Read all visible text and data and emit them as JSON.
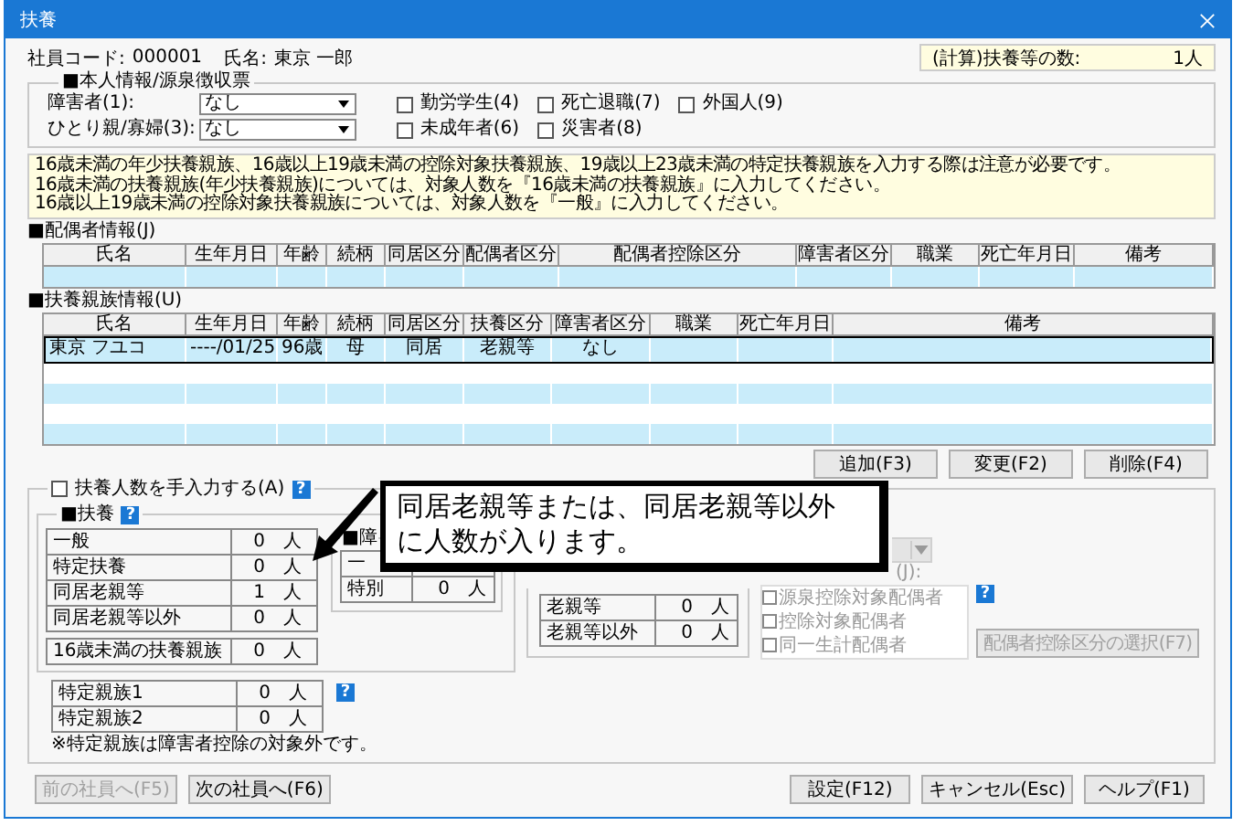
{
  "window": {
    "title": "扶養"
  },
  "employee": {
    "code_label": "社員コード:",
    "code": "000001",
    "name_label": "氏名:",
    "name": "東京 一郎"
  },
  "computed": {
    "label": "(計算)扶養等の数:",
    "value": "1人"
  },
  "self_info": {
    "title": "■本人情報/源泉徴収票",
    "selects": [
      {
        "label": "障害者(1):",
        "value": "なし"
      },
      {
        "label": "ひとり親/寡婦(3):",
        "value": "なし"
      }
    ],
    "checkboxes": [
      {
        "label": "勤労学生(4)",
        "checked": false
      },
      {
        "label": "死亡退職(7)",
        "checked": false
      },
      {
        "label": "外国人(9)",
        "checked": false
      },
      {
        "label": "未成年者(6)",
        "checked": false
      },
      {
        "label": "災害者(8)",
        "checked": false
      }
    ]
  },
  "note": {
    "lines": [
      "16歳未満の年少扶養親族、16歳以上19歳未満の控除対象扶養親族、19歳以上23歳未満の特定扶養親族を入力する際は注意が必要です。",
      "16歳未満の扶養親族(年少扶養親族)については、対象人数を『16歳未満の扶養親族』に入力してください。",
      "16歳以上19歳未満の控除対象扶養親族については、対象人数を『一般』に入力してください。"
    ]
  },
  "spouse_table": {
    "title": "■配偶者情報(J)",
    "columns": [
      "氏名",
      "生年月日",
      "年齢",
      "続柄",
      "同居区分",
      "配偶者区分",
      "配偶者控除区分",
      "障害者区分",
      "職業",
      "死亡年月日",
      "備考"
    ]
  },
  "dependents_table": {
    "title": "■扶養親族情報(U)",
    "columns": [
      "氏名",
      "生年月日",
      "年齢",
      "続柄",
      "同居区分",
      "扶養区分",
      "障害者区分",
      "職業",
      "死亡年月日",
      "備考"
    ],
    "rows": [
      {
        "cells": [
          "東京 フユコ",
          "----/01/25",
          "96歳",
          "母",
          "同居",
          "老親等",
          "なし"
        ],
        "selected": true
      }
    ]
  },
  "table_buttons": [
    {
      "label": "追加(F3)"
    },
    {
      "label": "変更(F2)"
    },
    {
      "label": "削除(F4)"
    }
  ],
  "manual_input": {
    "label": "扶養人数を手入力する(A)",
    "checked": false,
    "help": "?"
  },
  "dependents_group": {
    "title": "■扶養",
    "help": "?",
    "rows": [
      {
        "label": "一般",
        "value": "0",
        "unit": "人"
      },
      {
        "label": "特定扶養",
        "value": "0",
        "unit": "人"
      },
      {
        "label": "同居老親等",
        "value": "1",
        "unit": "人"
      },
      {
        "label": "同居老親等以外",
        "value": "0",
        "unit": "人"
      }
    ],
    "under16": {
      "label": "16歳未満の扶養親族",
      "value": "0",
      "unit": "人"
    }
  },
  "specific_relatives": {
    "help": "?",
    "rows": [
      {
        "label": "特定親族1",
        "value": "0",
        "unit": "人"
      },
      {
        "label": "特定親族2",
        "value": "0",
        "unit": "人"
      }
    ],
    "note": "※特定親族は障害者控除の対象外です。"
  },
  "disability_group": {
    "title": "■障",
    "rows": [
      {
        "label": "一"
      },
      {
        "label": "特別",
        "value": "0",
        "unit": "人"
      }
    ]
  },
  "elderly_group": {
    "rows": [
      {
        "label": "老親等",
        "value": "0",
        "unit": "人"
      },
      {
        "label": "老親等以外",
        "value": "0",
        "unit": "人"
      }
    ]
  },
  "spouse_panel": {
    "label": "(J):",
    "disabled": true,
    "help": "?",
    "options": [
      {
        "label": "源泉控除対象配偶者",
        "checked": false
      },
      {
        "label": "控除対象配偶者",
        "checked": false
      },
      {
        "label": "同一生計配偶者",
        "checked": false
      }
    ],
    "button": {
      "label": "配偶者控除区分の選択(F7)",
      "disabled": true
    }
  },
  "callout": {
    "lines": [
      "同居老親等または、同居老親等以外",
      "に人数が入ります。"
    ]
  },
  "footer_buttons": [
    {
      "label": "前の社員へ(F5)",
      "disabled": true
    },
    {
      "label": "次の社員へ(F6)",
      "disabled": false
    },
    {
      "label": "設定(F12)",
      "disabled": false
    },
    {
      "label": "キャンセル(Esc)",
      "disabled": false
    },
    {
      "label": "ヘルプ(F1)",
      "disabled": false
    }
  ]
}
